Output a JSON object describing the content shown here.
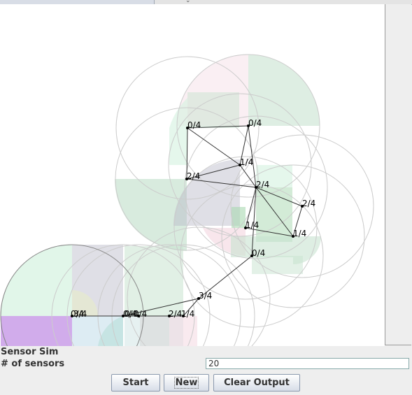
{
  "app": {
    "title": "Sensor Sim"
  },
  "controls": {
    "count_label": "# of sensors",
    "count_value": "20",
    "start_label": "Start",
    "new_label": "New",
    "clear_label": "Clear Output"
  },
  "sensors": [
    {
      "id": 0,
      "label": "0/4"
    },
    {
      "id": 1,
      "label": "0/4"
    },
    {
      "id": 2,
      "label": "1/4"
    },
    {
      "id": 3,
      "label": "2/4"
    },
    {
      "id": 4,
      "label": "2/4"
    },
    {
      "id": 5,
      "label": "2/4"
    },
    {
      "id": 6,
      "label": "1/4"
    },
    {
      "id": 7,
      "label": "1/4"
    },
    {
      "id": 8,
      "label": "0/4"
    },
    {
      "id": 9,
      "label": "3/4"
    },
    {
      "id": 10,
      "label": "0/4"
    },
    {
      "id": 11,
      "label": "3/4"
    },
    {
      "id": 12,
      "label": "0/4"
    },
    {
      "id": 13,
      "label": "2/4"
    },
    {
      "id": 14,
      "label": "1/4"
    },
    {
      "id": 15,
      "label": "0/4"
    }
  ],
  "colors": {
    "green_fill": "#c8e3d0",
    "pink_fill": "#f3d6e0",
    "mint_fill": "#d4f2df",
    "purple_fill": "#c99ee8",
    "gray_fill": "#b8b8c8",
    "link_stroke": "#333333",
    "range_stroke": "#cccccc"
  }
}
